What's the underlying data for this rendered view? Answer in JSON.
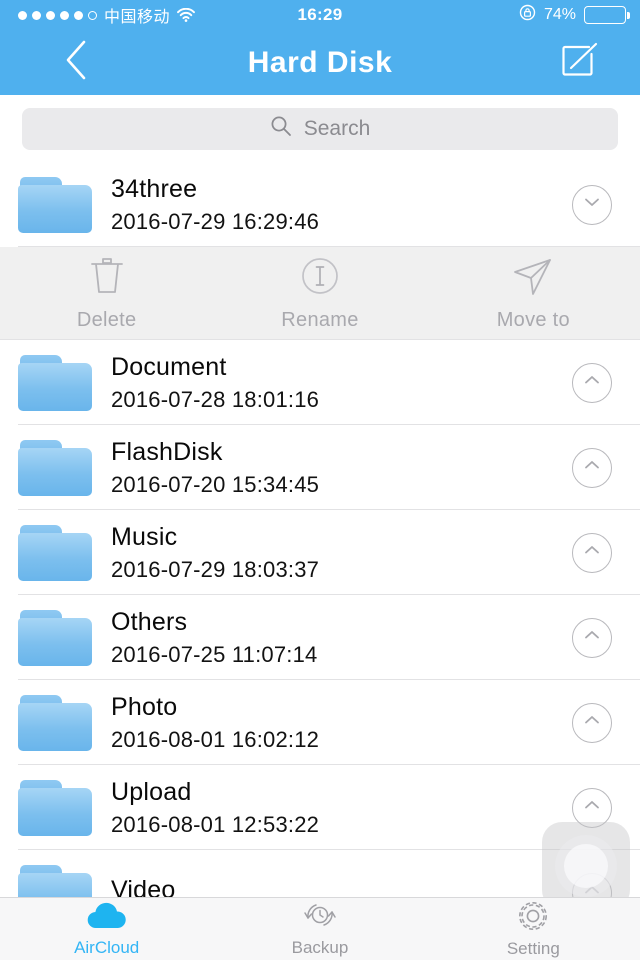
{
  "status_bar": {
    "signal_dots_filled": 5,
    "signal_dots_total": 6,
    "carrier": "中国移动",
    "wifi_icon": "wifi-icon",
    "time": "16:29",
    "rotation_lock_icon": "rotation-lock-icon",
    "battery_percent": "74%",
    "battery_level": 74
  },
  "navbar": {
    "back_icon": "chevron-left-icon",
    "title": "Hard Disk",
    "edit_icon": "compose-edit-icon"
  },
  "search": {
    "icon": "search-icon",
    "placeholder": "Search"
  },
  "action_bar": {
    "actions": [
      {
        "label": "Delete",
        "icon": "trash-icon"
      },
      {
        "label": "Rename",
        "icon": "rename-circle-i-icon"
      },
      {
        "label": "Move to",
        "icon": "paper-plane-icon"
      }
    ]
  },
  "files": [
    {
      "name": "34three",
      "date": "2016-07-29 16:29:46",
      "icon": "folder-icon",
      "expanded": true,
      "chevron": "chevron-down-icon"
    },
    {
      "name": "Document",
      "date": "2016-07-28 18:01:16",
      "icon": "folder-icon",
      "expanded": false,
      "chevron": "chevron-up-icon"
    },
    {
      "name": "FlashDisk",
      "date": "2016-07-20 15:34:45",
      "icon": "folder-icon",
      "expanded": false,
      "chevron": "chevron-up-icon"
    },
    {
      "name": "Music",
      "date": "2016-07-29 18:03:37",
      "icon": "folder-icon",
      "expanded": false,
      "chevron": "chevron-up-icon"
    },
    {
      "name": "Others",
      "date": "2016-07-25 11:07:14",
      "icon": "folder-icon",
      "expanded": false,
      "chevron": "chevron-up-icon"
    },
    {
      "name": "Photo",
      "date": "2016-08-01 16:02:12",
      "icon": "folder-icon",
      "expanded": false,
      "chevron": "chevron-up-icon"
    },
    {
      "name": "Upload",
      "date": "2016-08-01 12:53:22",
      "icon": "folder-icon",
      "expanded": false,
      "chevron": "chevron-up-icon"
    },
    {
      "name": "Video",
      "date": "",
      "icon": "folder-icon",
      "expanded": false,
      "chevron": "chevron-up-icon"
    }
  ],
  "tabbar": {
    "tabs": [
      {
        "label": "AirCloud",
        "icon": "cloud-icon",
        "active": true
      },
      {
        "label": "Backup",
        "icon": "backup-sync-clock-icon",
        "active": false
      },
      {
        "label": "Setting",
        "icon": "gear-icon",
        "active": false
      }
    ]
  },
  "overlay": {
    "assistive_touch_icon": "assistive-touch-icon"
  },
  "colors": {
    "nav_blue": "#4FB0EE",
    "accent_blue": "#33B5F5",
    "folder_blue": "#7CBFEE",
    "action_bar_bg": "#F0F0F0",
    "search_bg": "#EAEAEC",
    "tabbar_bg": "#F7F7F8",
    "inactive_gray": "#A9A9AE"
  }
}
